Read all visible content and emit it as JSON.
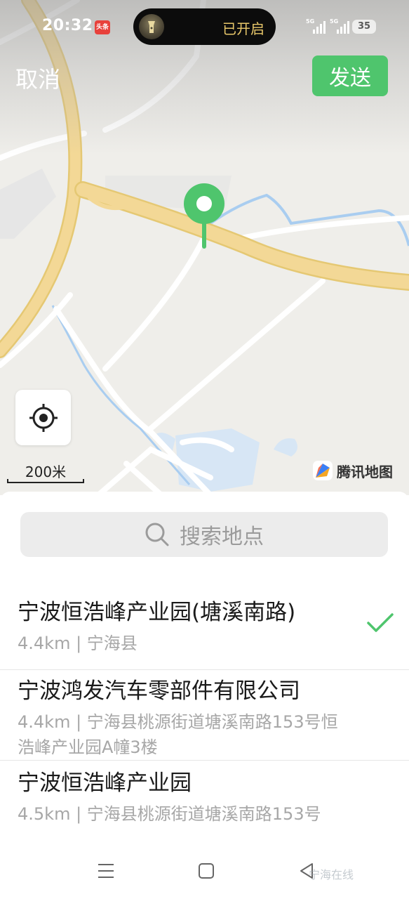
{
  "status_bar": {
    "time": "20:32",
    "app_badge": "头条",
    "island_text": "已开启",
    "signal_1": "5G",
    "signal_2": "5G",
    "battery": "35"
  },
  "header": {
    "cancel_label": "取消",
    "send_label": "发送"
  },
  "map": {
    "scale_label": "200米",
    "logo_text": "腾讯地图",
    "pin_color": "#4fc56d"
  },
  "search": {
    "placeholder": "搜索地点"
  },
  "results": [
    {
      "title": "宁波恒浩峰产业园(塘溪南路)",
      "subtitle": "4.4km | 宁海县",
      "selected": true
    },
    {
      "title": "宁波鸿发汽车零部件有限公司",
      "subtitle": "4.4km | 宁海县桃源街道塘溪南路153号恒浩峰产业园A幢3楼",
      "selected": false
    },
    {
      "title": "宁波恒浩峰产业园",
      "subtitle": "4.5km | 宁海县桃源街道塘溪南路153号",
      "selected": false
    }
  ],
  "nav": {
    "watermark": "宁海在线"
  },
  "colors": {
    "accent": "#4fc56d",
    "road_major": "#f3d896",
    "water": "#a9cdf0"
  }
}
